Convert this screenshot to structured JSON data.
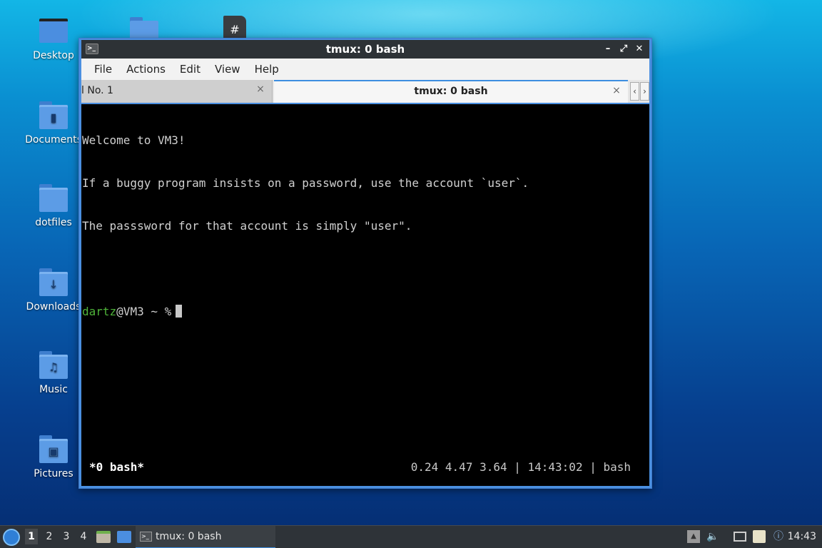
{
  "desktop": {
    "icons": [
      {
        "label": "Desktop",
        "glyph": "monitor"
      },
      {
        "label": "Documents",
        "glyph": "document"
      },
      {
        "label": "dotfiles",
        "glyph": ""
      },
      {
        "label": "Downloads",
        "glyph": "↓"
      },
      {
        "label": "Music",
        "glyph": "♫"
      },
      {
        "label": "Pictures",
        "glyph": "▣"
      }
    ]
  },
  "window": {
    "title": "tmux: 0 bash",
    "menu": [
      "File",
      "Actions",
      "Edit",
      "View",
      "Help"
    ],
    "tabs": [
      {
        "label": "l No. 1",
        "active": false
      },
      {
        "label": "tmux: 0 bash",
        "active": true
      }
    ],
    "tab_close_symbol": "×",
    "tab_scroll_left": "‹",
    "tab_scroll_right": "›",
    "buttons": {
      "minimize": "–",
      "maximize": "⤢",
      "close": "✕"
    }
  },
  "terminal": {
    "lines": [
      "Welcome to VM3!",
      "If a buggy program insists on a password, use the account `user`.",
      "The passsword for that account is simply \"user\".",
      ""
    ],
    "prompt": {
      "user": "dartz",
      "rest": "@VM3 ~ %"
    },
    "status_left": "*0 bash*",
    "status_right": "0.24 4.47 3.64 | 14:43:02 | bash",
    "colors": {
      "prompt_user": "#4fb43a",
      "background": "#000000",
      "text": "#d0d0d0"
    }
  },
  "taskbar": {
    "workspaces": [
      "1",
      "2",
      "3",
      "4"
    ],
    "active_workspace": "1",
    "task_label": "tmux: 0 bash",
    "clock": "14:43"
  }
}
